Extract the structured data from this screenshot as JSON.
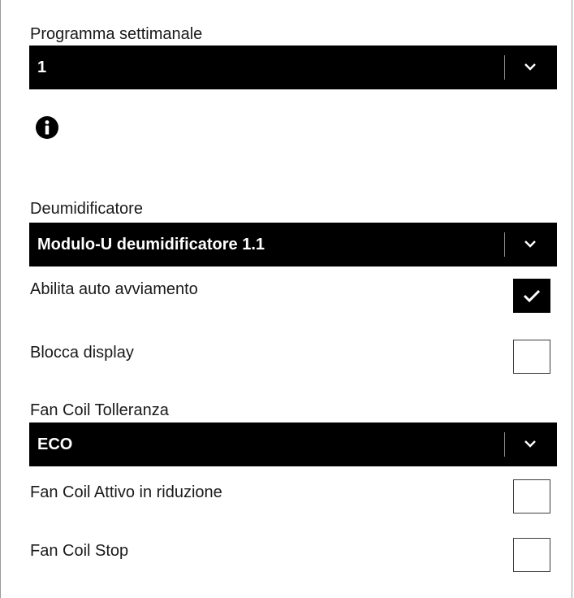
{
  "weekly_program": {
    "label": "Programma settimanale",
    "value": "1"
  },
  "info_icon": "info-circle-icon",
  "dehumidifier": {
    "label": "Deumidificatore",
    "value": "Modulo-U deumidificatore 1.1"
  },
  "auto_start": {
    "label": "Abilita auto avviamento",
    "checked": true
  },
  "lock_display": {
    "label": "Blocca display",
    "checked": false
  },
  "fan_coil_tolerance": {
    "label": "Fan Coil Tolleranza",
    "value": "ECO"
  },
  "fan_coil_active_reduction": {
    "label": "Fan Coil Attivo in riduzione",
    "checked": false
  },
  "fan_coil_stop": {
    "label": "Fan Coil Stop",
    "checked": false
  },
  "colors": {
    "select_background": "#000000",
    "select_text": "#ffffff",
    "checkbox_checked": "#000000",
    "checkbox_border": "#3c3c3c"
  }
}
